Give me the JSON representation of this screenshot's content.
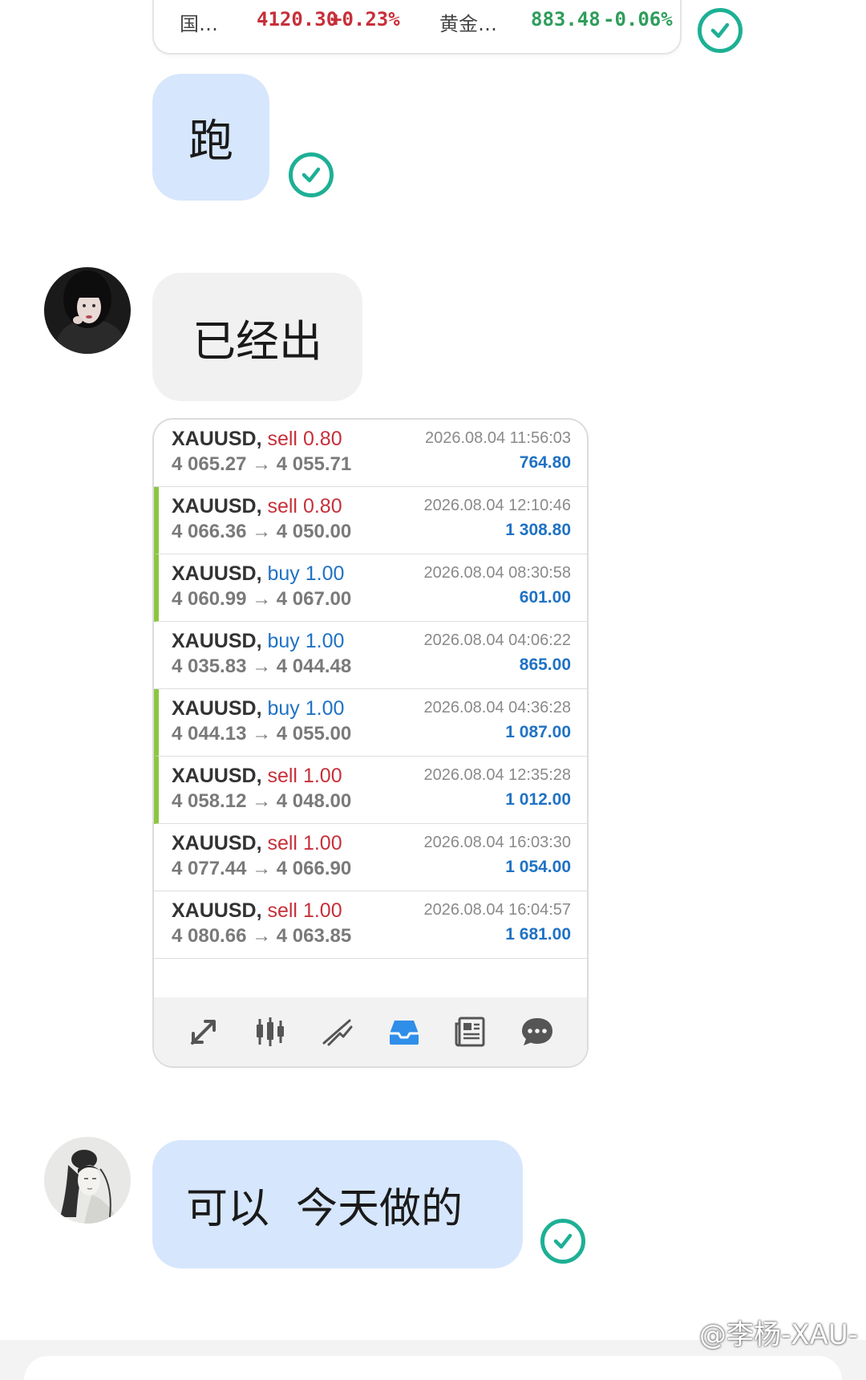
{
  "ticker": {
    "item1_name": "国…",
    "item1_price": "4120.30",
    "item1_change": "+0.23%",
    "item2_name": "黄金…",
    "item2_price": "883.48",
    "item2_change": "-0.06%",
    "up_color": "#c7303a",
    "down_color": "#2e9d5b"
  },
  "messages": {
    "msg1": "跑",
    "msg2": "已经出",
    "msg3": "可以  今天做的"
  },
  "trades": [
    {
      "symbol": "XAUUSD,",
      "side": "sell",
      "lots": "0.80",
      "prices": "4 065.27 → 4 055.71",
      "time": "2026.08.04 11:56:03",
      "profit": "764.80"
    },
    {
      "symbol": "XAUUSD,",
      "side": "sell",
      "lots": "0.80",
      "prices": "4 066.36 → 4 050.00",
      "time": "2026.08.04 12:10:46",
      "profit": "1 308.80"
    },
    {
      "symbol": "XAUUSD,",
      "side": "buy",
      "lots": "1.00",
      "prices": "4 060.99 → 4 067.00",
      "time": "2026.08.04 08:30:58",
      "profit": "601.00"
    },
    {
      "symbol": "XAUUSD,",
      "side": "buy",
      "lots": "1.00",
      "prices": "4 035.83 → 4 044.48",
      "time": "2026.08.04 04:06:22",
      "profit": "865.00"
    },
    {
      "symbol": "XAUUSD,",
      "side": "buy",
      "lots": "1.00",
      "prices": "4 044.13 → 4 055.00",
      "time": "2026.08.04 04:36:28",
      "profit": "1 087.00"
    },
    {
      "symbol": "XAUUSD,",
      "side": "sell",
      "lots": "1.00",
      "prices": "4 058.12 → 4 048.00",
      "time": "2026.08.04 12:35:28",
      "profit": "1 012.00"
    },
    {
      "symbol": "XAUUSD,",
      "side": "sell",
      "lots": "1.00",
      "prices": "4 077.44 → 4 066.90",
      "time": "2026.08.04 16:03:30",
      "profit": "1 054.00"
    },
    {
      "symbol": "XAUUSD,",
      "side": "sell",
      "lots": "1.00",
      "prices": "4 080.66 → 4 063.85",
      "time": "2026.08.04 16:04:57",
      "profit": "1 681.00"
    }
  ],
  "tabs": [
    "trade-icon",
    "candles-icon",
    "chart-icon",
    "history-icon",
    "news-icon",
    "chat-icon"
  ],
  "watermark": "@李杨-XAU-",
  "colors": {
    "sent_bubble": "#d6e6fc",
    "recv_bubble": "#f1f1f1",
    "check": "#1db095",
    "profit": "#1f72c4",
    "highlight_bar": "#8cc63f",
    "active_tab": "#2f8ee8"
  }
}
